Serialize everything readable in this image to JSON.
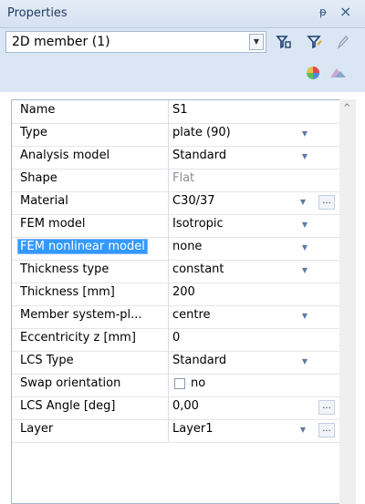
{
  "panel": {
    "title": "Properties",
    "pin_glyph": "ᵽ",
    "close_glyph": "×"
  },
  "selector": {
    "value": "2D member (1)"
  },
  "rows": [
    {
      "label": "Name",
      "value": "S1"
    },
    {
      "label": "Type",
      "value": "plate (90)"
    },
    {
      "label": "Analysis model",
      "value": "Standard"
    },
    {
      "label": "Shape",
      "value": "Flat"
    },
    {
      "label": "Material",
      "value": "C30/37"
    },
    {
      "label": "FEM model",
      "value": "Isotropic"
    },
    {
      "label": "FEM nonlinear model",
      "value": "none"
    },
    {
      "label": "Thickness type",
      "value": "constant"
    },
    {
      "label": "Thickness [mm]",
      "value": "200"
    },
    {
      "label": "Member system-pl...",
      "value": "centre"
    },
    {
      "label": "Eccentricity z [mm]",
      "value": "0"
    },
    {
      "label": "LCS Type",
      "value": "Standard"
    },
    {
      "label": "Swap orientation",
      "value": "no"
    },
    {
      "label": "LCS Angle [deg]",
      "value": "0,00"
    },
    {
      "label": "Layer",
      "value": "Layer1"
    }
  ],
  "icons": {
    "dropdown": "▼",
    "ellipsis": "...",
    "scroll_up": "^"
  }
}
